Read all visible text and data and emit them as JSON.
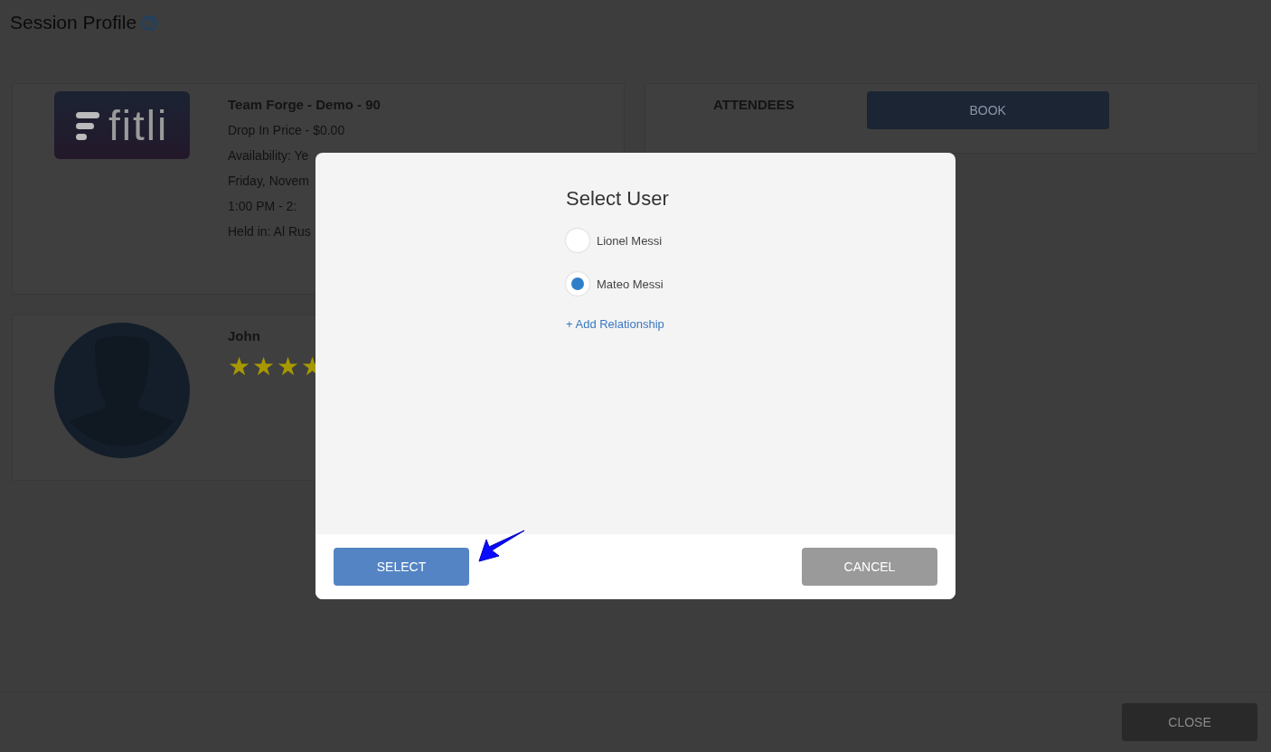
{
  "page": {
    "title": "Session Profile"
  },
  "session": {
    "logo_text": "fitli",
    "name": "Team Forge - Demo - 90",
    "details": [
      "Drop In Price - $0.00",
      "Availability: Ye",
      "Friday, Novem",
      "1:00 PM - 2:",
      "Held in: Al Rus"
    ]
  },
  "attendees": {
    "heading": "ATTENDEES",
    "book_button": "BOOK"
  },
  "instructor": {
    "name": "John",
    "stars": 4
  },
  "dialog": {
    "title": "Select User",
    "users": [
      {
        "name": "Lionel Messi",
        "selected": false
      },
      {
        "name": "Mateo Messi",
        "selected": true
      }
    ],
    "add_link": "+ Add Relationship",
    "select_button": "SELECT",
    "cancel_button": "CANCEL"
  },
  "footer": {
    "close_button": "CLOSE"
  }
}
